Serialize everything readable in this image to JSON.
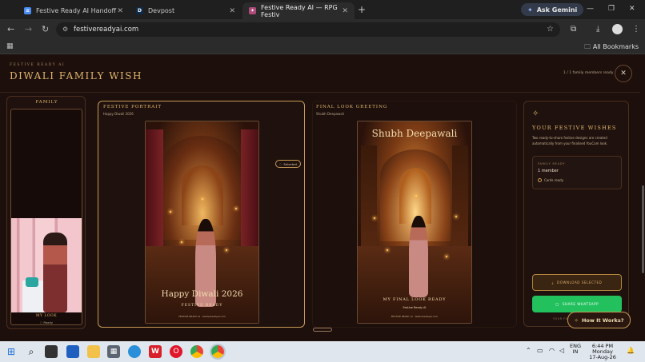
{
  "browser": {
    "tabs": [
      {
        "title": "Festive Ready AI Handoff",
        "icon": "doc-icon"
      },
      {
        "title": "Devpost",
        "icon": "devpost-icon"
      },
      {
        "title": "Festive Ready AI — RPG Festiv",
        "icon": "festive-icon"
      }
    ],
    "gemini_label": "Ask Gemini",
    "url": "festivereadyai.com",
    "all_bookmarks": "All Bookmarks"
  },
  "app": {
    "eyebrow": "Festive Ready AI",
    "title": "Diwali Family Wish",
    "ready_count": "1 / 1 family members ready",
    "family": {
      "label": "Family",
      "member_name": "My Look",
      "member_status": "Ready"
    },
    "portrait_card": {
      "label": "Festive Portrait",
      "subtitle": "Happy Diwali 2026",
      "selected_label": "Selected",
      "greeting": "Happy Diwali 2026",
      "tagline": "Festive Ready",
      "footer": "FESTIVE READY AI · festivereadyai.com"
    },
    "final_card": {
      "label": "Final Look Greeting",
      "subtitle": "Shubh Deepawali",
      "greeting": "Shubh Deepawali",
      "tagline": "My Final Look Ready",
      "brand": "Festive Ready AI",
      "footer": "FESTIVE READY AI · festivereadyai.com"
    },
    "wishes": {
      "title": "Your Festive Wishes",
      "description": "Two ready-to-share festive designs are created automatically from your finalised YouCam look.",
      "family_ready_label": "Family Ready",
      "member_count": "1 member",
      "cards_ready": "Cards ready",
      "download_label": "Download Selected",
      "whatsapp_label": "Share WhatsApp",
      "cut_text": "Your festive look"
    },
    "how_it_works": "How It Works?"
  },
  "taskbar": {
    "lang_top": "ENG",
    "lang_bottom": "IN",
    "time": "6:44 PM",
    "day": "Monday",
    "date": "17-Aug-26"
  },
  "colors": {
    "accent_gold": "#e0b66d",
    "whatsapp_green": "#22c15e",
    "background": "#1c0f0c"
  }
}
